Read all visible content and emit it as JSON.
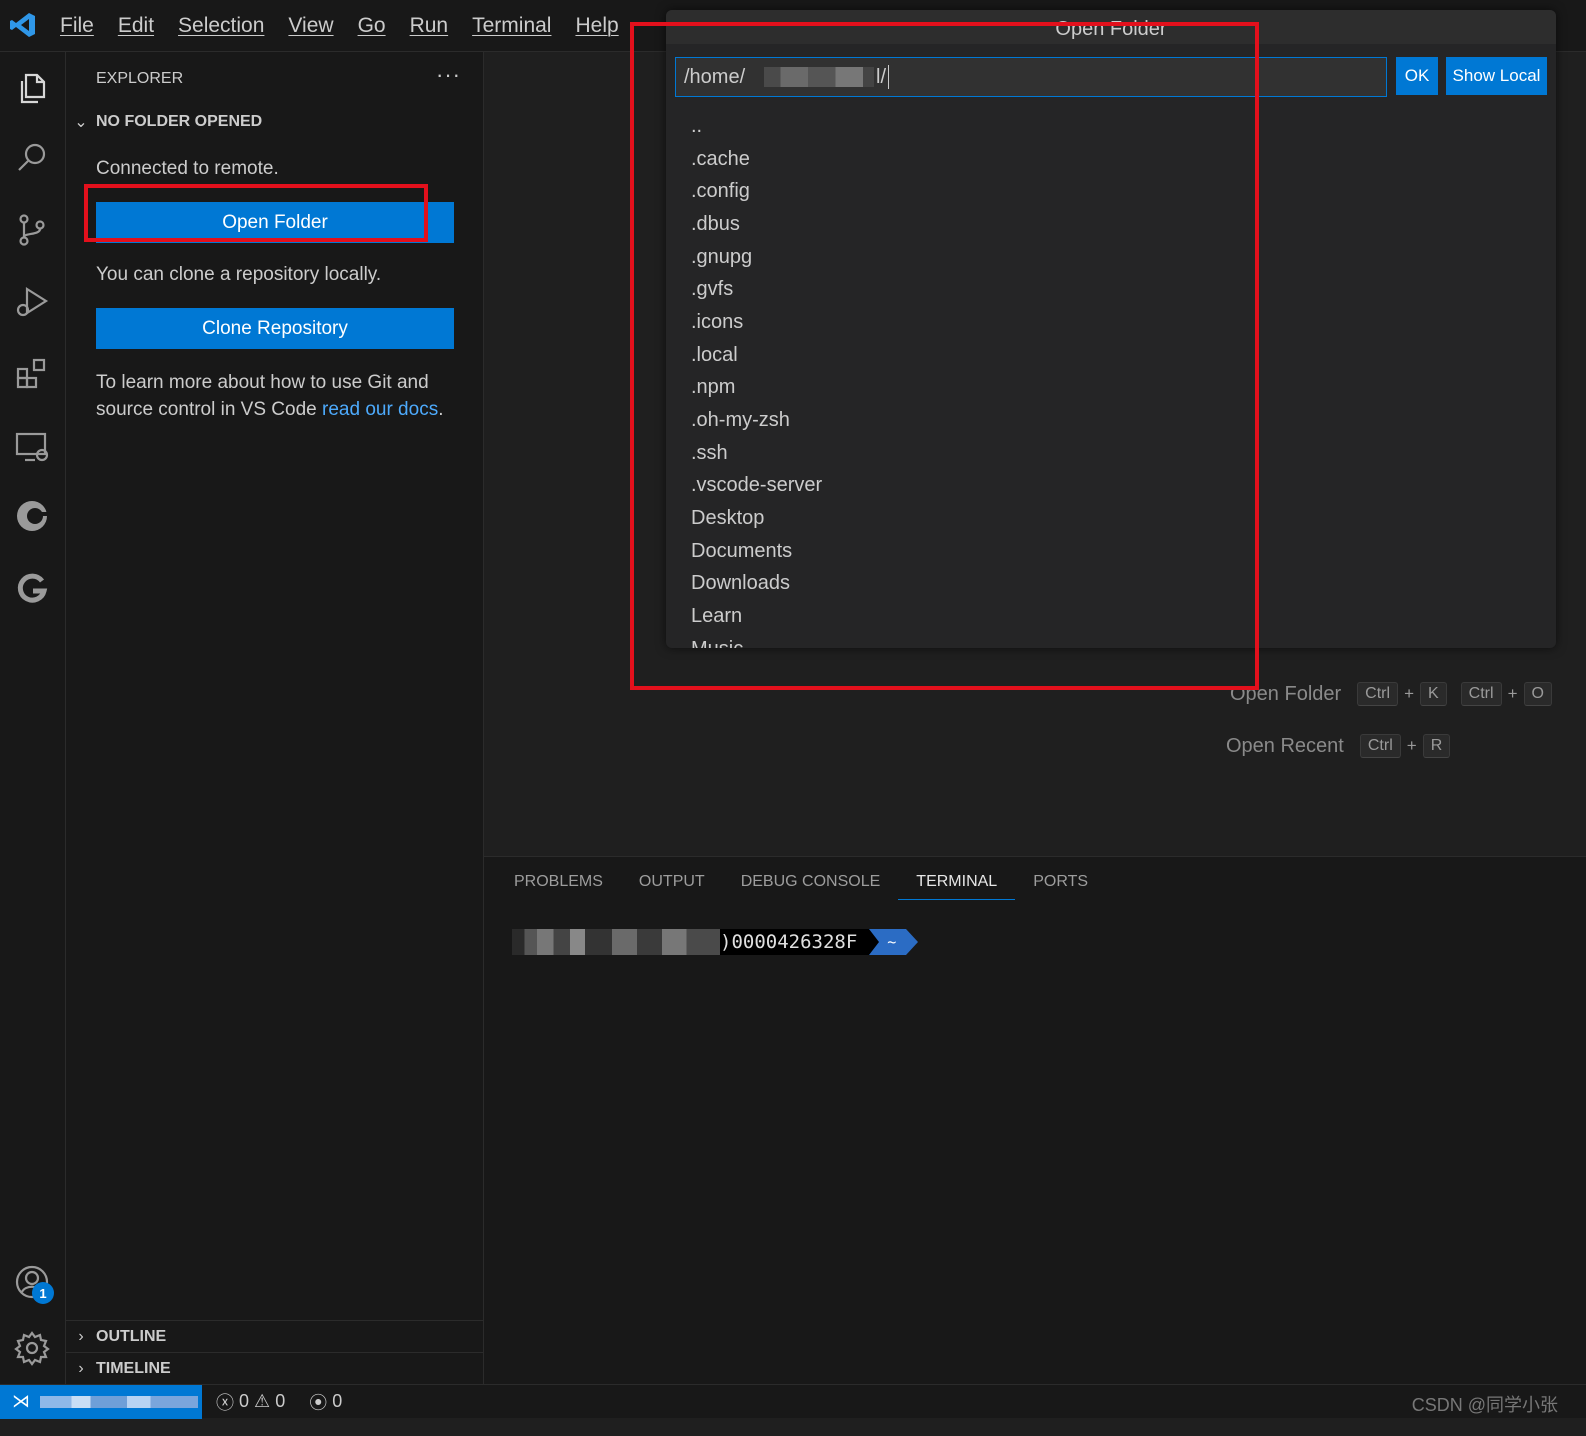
{
  "menu": [
    "File",
    "Edit",
    "Selection",
    "View",
    "Go",
    "Run",
    "Terminal",
    "Help"
  ],
  "activity_bar": {
    "icons": [
      "explorer-icon",
      "search-icon",
      "source-control-icon",
      "run-debug-icon",
      "extensions-icon",
      "remote-explorer-icon",
      "codegeex-icon",
      "gitlens-icon"
    ],
    "account_icon": "account-icon",
    "account_badge": "1",
    "settings_icon": "gear-icon"
  },
  "sidebar": {
    "title": "EXPLORER",
    "more": "···",
    "section": "NO FOLDER OPENED",
    "connected_text": "Connected to remote.",
    "open_folder_label": "Open Folder",
    "clone_text": "You can clone a repository locally.",
    "clone_label": "Clone Repository",
    "learn_text": "To learn more about how to use Git and source control in VS Code ",
    "learn_link": "read our docs",
    "learn_end": ".",
    "outline": "OUTLINE",
    "timeline": "TIMELINE"
  },
  "editor": {
    "shortcuts": [
      {
        "label": "Open Folder",
        "keys1": [
          "Ctrl",
          "K"
        ],
        "keys2": [
          "Ctrl",
          "O"
        ]
      },
      {
        "label": "Open Recent",
        "keys1": [
          "Ctrl",
          "R"
        ]
      }
    ]
  },
  "panel": {
    "tabs": [
      "PROBLEMS",
      "OUTPUT",
      "DEBUG CONSOLE",
      "TERMINAL",
      "PORTS"
    ],
    "active_tab": "TERMINAL",
    "terminal_host_suffix": ")0000426328F",
    "terminal_cwd": "~"
  },
  "quick_pick": {
    "title": "Open Folder",
    "input_value": "/home/",
    "input_suffix": "l/",
    "ok_label": "OK",
    "show_local_label": "Show Local",
    "items": [
      "..",
      ".cache",
      ".config",
      ".dbus",
      ".gnupg",
      ".gvfs",
      ".icons",
      ".local",
      ".npm",
      ".oh-my-zsh",
      ".ssh",
      ".vscode-server",
      "Desktop",
      "Documents",
      "Downloads",
      "Learn",
      "Music"
    ]
  },
  "status_bar": {
    "errors": "0",
    "warnings": "0",
    "ports": "0",
    "watermark": "CSDN @同学小张"
  },
  "colors": {
    "accent": "#0078d4",
    "annotation": "#e3101c",
    "link": "#4daafc"
  }
}
